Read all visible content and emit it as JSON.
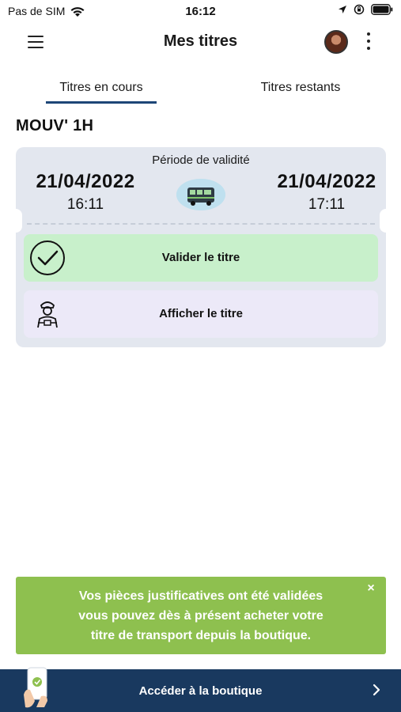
{
  "status_bar": {
    "carrier": "Pas de SIM",
    "time": "16:12",
    "wifi_icon": "wifi-icon",
    "location_icon": "location-arrow-icon",
    "lock_icon": "rotation-lock-icon",
    "battery_icon": "battery-icon"
  },
  "header": {
    "title": "Mes titres",
    "menu_icon": "hamburger-menu-icon",
    "avatar": "user-avatar",
    "more_icon": "more-vertical-icon"
  },
  "tabs": [
    {
      "label": "Titres en cours",
      "active": true
    },
    {
      "label": "Titres restants",
      "active": false
    }
  ],
  "ticket": {
    "name": "MOUV' 1H",
    "validity_label": "Période de validité",
    "start": {
      "date": "21/04/2022",
      "time": "16:11"
    },
    "end": {
      "date": "21/04/2022",
      "time": "17:11"
    },
    "bus_icon": "bus-icon",
    "actions": {
      "validate": {
        "label": "Valider le titre",
        "icon": "check-circle-icon"
      },
      "show": {
        "label": "Afficher le titre",
        "icon": "inspector-icon"
      }
    }
  },
  "notification": {
    "line1": "Vos pièces justificatives ont été validées",
    "line2": "vous pouvez dès à présent acheter votre",
    "line3": "titre de transport depuis la boutique.",
    "close": "×"
  },
  "shop_bar": {
    "label": "Accéder à la boutique",
    "icon": "phone-in-hand-icon",
    "chevron_icon": "chevron-right-icon"
  },
  "colors": {
    "primary": "#19395f",
    "tab_underline": "#1d4677",
    "validate_bg": "#c8f0cb",
    "show_bg": "#ece9f8",
    "ticket_bg": "#e3e7ef",
    "notification_bg": "#8ec04f"
  }
}
